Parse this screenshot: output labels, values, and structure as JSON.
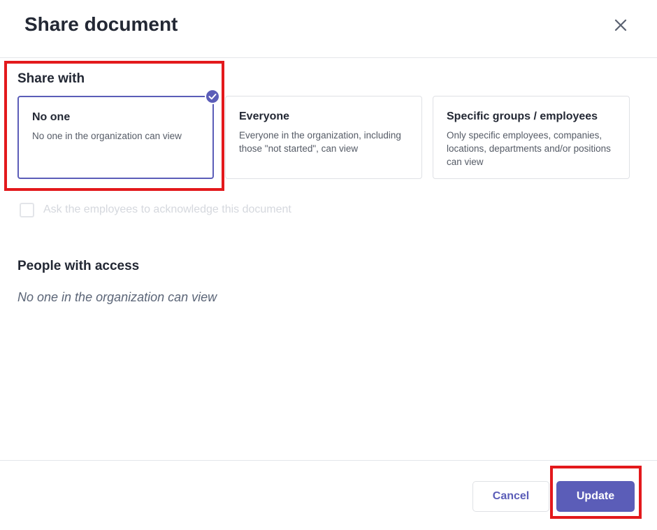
{
  "dialog": {
    "title": "Share document",
    "close_icon": "close-icon"
  },
  "share_with": {
    "title": "Share with",
    "options": [
      {
        "title": "No one",
        "description": "No one in the organization can view",
        "selected": true
      },
      {
        "title": "Everyone",
        "description": "Everyone in the organization, including those \"not started\", can view",
        "selected": false
      },
      {
        "title": "Specific groups / employees",
        "description": "Only specific employees, companies, locations, departments and/or positions can view",
        "selected": false
      }
    ],
    "selected_icon": "check-circle-icon"
  },
  "acknowledge": {
    "label": "Ask the employees to acknowledge this document",
    "checked": false,
    "disabled": true
  },
  "people_with_access": {
    "title": "People with access",
    "value": "No one in the organization can view"
  },
  "footer": {
    "cancel_label": "Cancel",
    "update_label": "Update"
  },
  "colors": {
    "accent": "#5b5db8",
    "highlight": "#e3191c",
    "text": "#232834",
    "muted": "#5b6577"
  }
}
